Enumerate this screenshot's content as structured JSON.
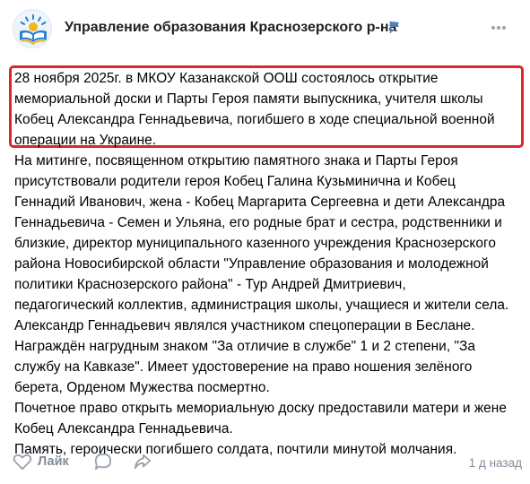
{
  "header": {
    "group_name": "Управление образования Краснозерского р-на",
    "avatar_icon": "education-open-book-logo-icon",
    "verified_icon": "blue-flag-icon",
    "more_icon": "three-dots-icon"
  },
  "post": {
    "intro_text": "28 ноября 2025г. в МКОУ Казанакской ООШ состоялось открытие\nмемориальной доски и Парты Героя памяти выпускника, учителя школы\nКобец Александра Геннадьевича, погибшего в ходе специальной военной\nоперации на Украине.",
    "body_text": "На митинге, посвященном открытию памятного знака и Парты Героя\nприсутствовали родители героя Кобец Галина Кузьминична и Кобец\nГеннадий Иванович, жена - Кобец Маргарита Сергеевна и дети Александра\nГеннадьевича - Семен и Ульяна, его родные брат и сестра, родственники и\nблизкие, директор муниципального казенного учреждения Краснозерского\nрайона Новосибирской области \"Управление образования и молодежной\nполитики Краснозерского района\" - Тур Андрей Дмитриевич,\nпедагогический коллектив, администрация школы, учащиеся и жители села.\nАлександр Геннадьевич являлся участником спецоперации в Беслане.\nНаграждён нагрудным знаком \"За отличие в службе\" 1 и 2 степени, \"За\nслужбу на Кавказе\". Имеет удостоверение на право ношения зелёного\nберета, Орденом Мужества посмертно.\nПочетное право открыть мемориальную доску предоставили матери и жене\nКобец Александра Геннадьевича.\nПамять, героически погибшего солдата, почтили минутой молчания.",
    "highlight_color": "#e0242b"
  },
  "footer": {
    "like_label": "Лайк",
    "like_icon": "heart-icon",
    "comment_icon": "comment-bubble-icon",
    "share_icon": "share-arrow-icon",
    "time": "1 д назад",
    "muted_color": "#818c99"
  }
}
